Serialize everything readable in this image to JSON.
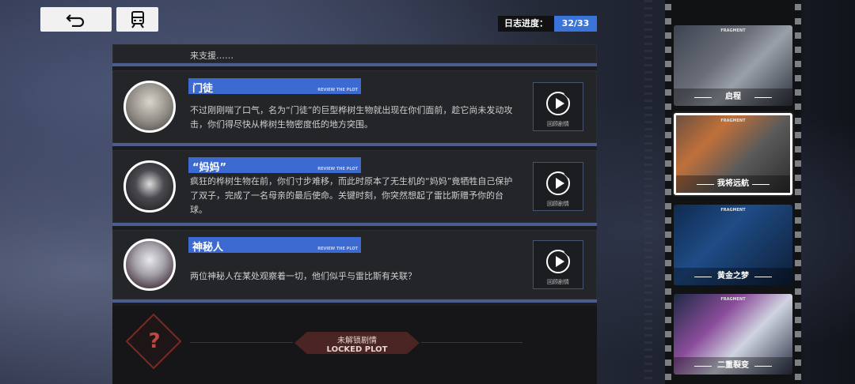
{
  "nav": {
    "back_icon": "back-arrow-icon",
    "train_icon": "train-icon"
  },
  "progress": {
    "label": "日志进度：",
    "value": "32/33"
  },
  "entries": [
    {
      "desc": "来支援……"
    },
    {
      "title": "门徒",
      "sub": "REVIEW THE PLOT",
      "desc": "不过刚刚喘了口气，名为“门徒”的巨型桦树生物就出现在你们面前，趁它尚未发动攻击，你们得尽快从桦树生物密度低的地方突围。",
      "replay": "回顾剧情"
    },
    {
      "title": "“妈妈”",
      "sub": "REVIEW THE PLOT",
      "desc": "疯狂的桦树生物在前，你们寸步难移，而此时原本了无生机的“妈妈”竟牺牲自己保护了双子，完成了一名母亲的最后使命。关键时刻，你突然想起了雷比斯赠予你的台球。",
      "replay": "回顾剧情"
    },
    {
      "title": "神秘人",
      "sub": "REVIEW THE PLOT",
      "desc": "两位神秘人在某处观察着一切，他们似乎与雷比斯有关联？",
      "replay": "回顾剧情"
    }
  ],
  "locked": {
    "cn": "未解锁剧情",
    "en": "LOCKED PLOT",
    "icon": "question-icon"
  },
  "chapters": [
    {
      "frag": "FRAGMENT",
      "name": "启程"
    },
    {
      "frag": "FRAGMENT",
      "name": "我将远航"
    },
    {
      "frag": "FRAGMENT",
      "name": "黄金之梦"
    },
    {
      "frag": "FRAGMENT",
      "name": "二重裂变"
    }
  ]
}
